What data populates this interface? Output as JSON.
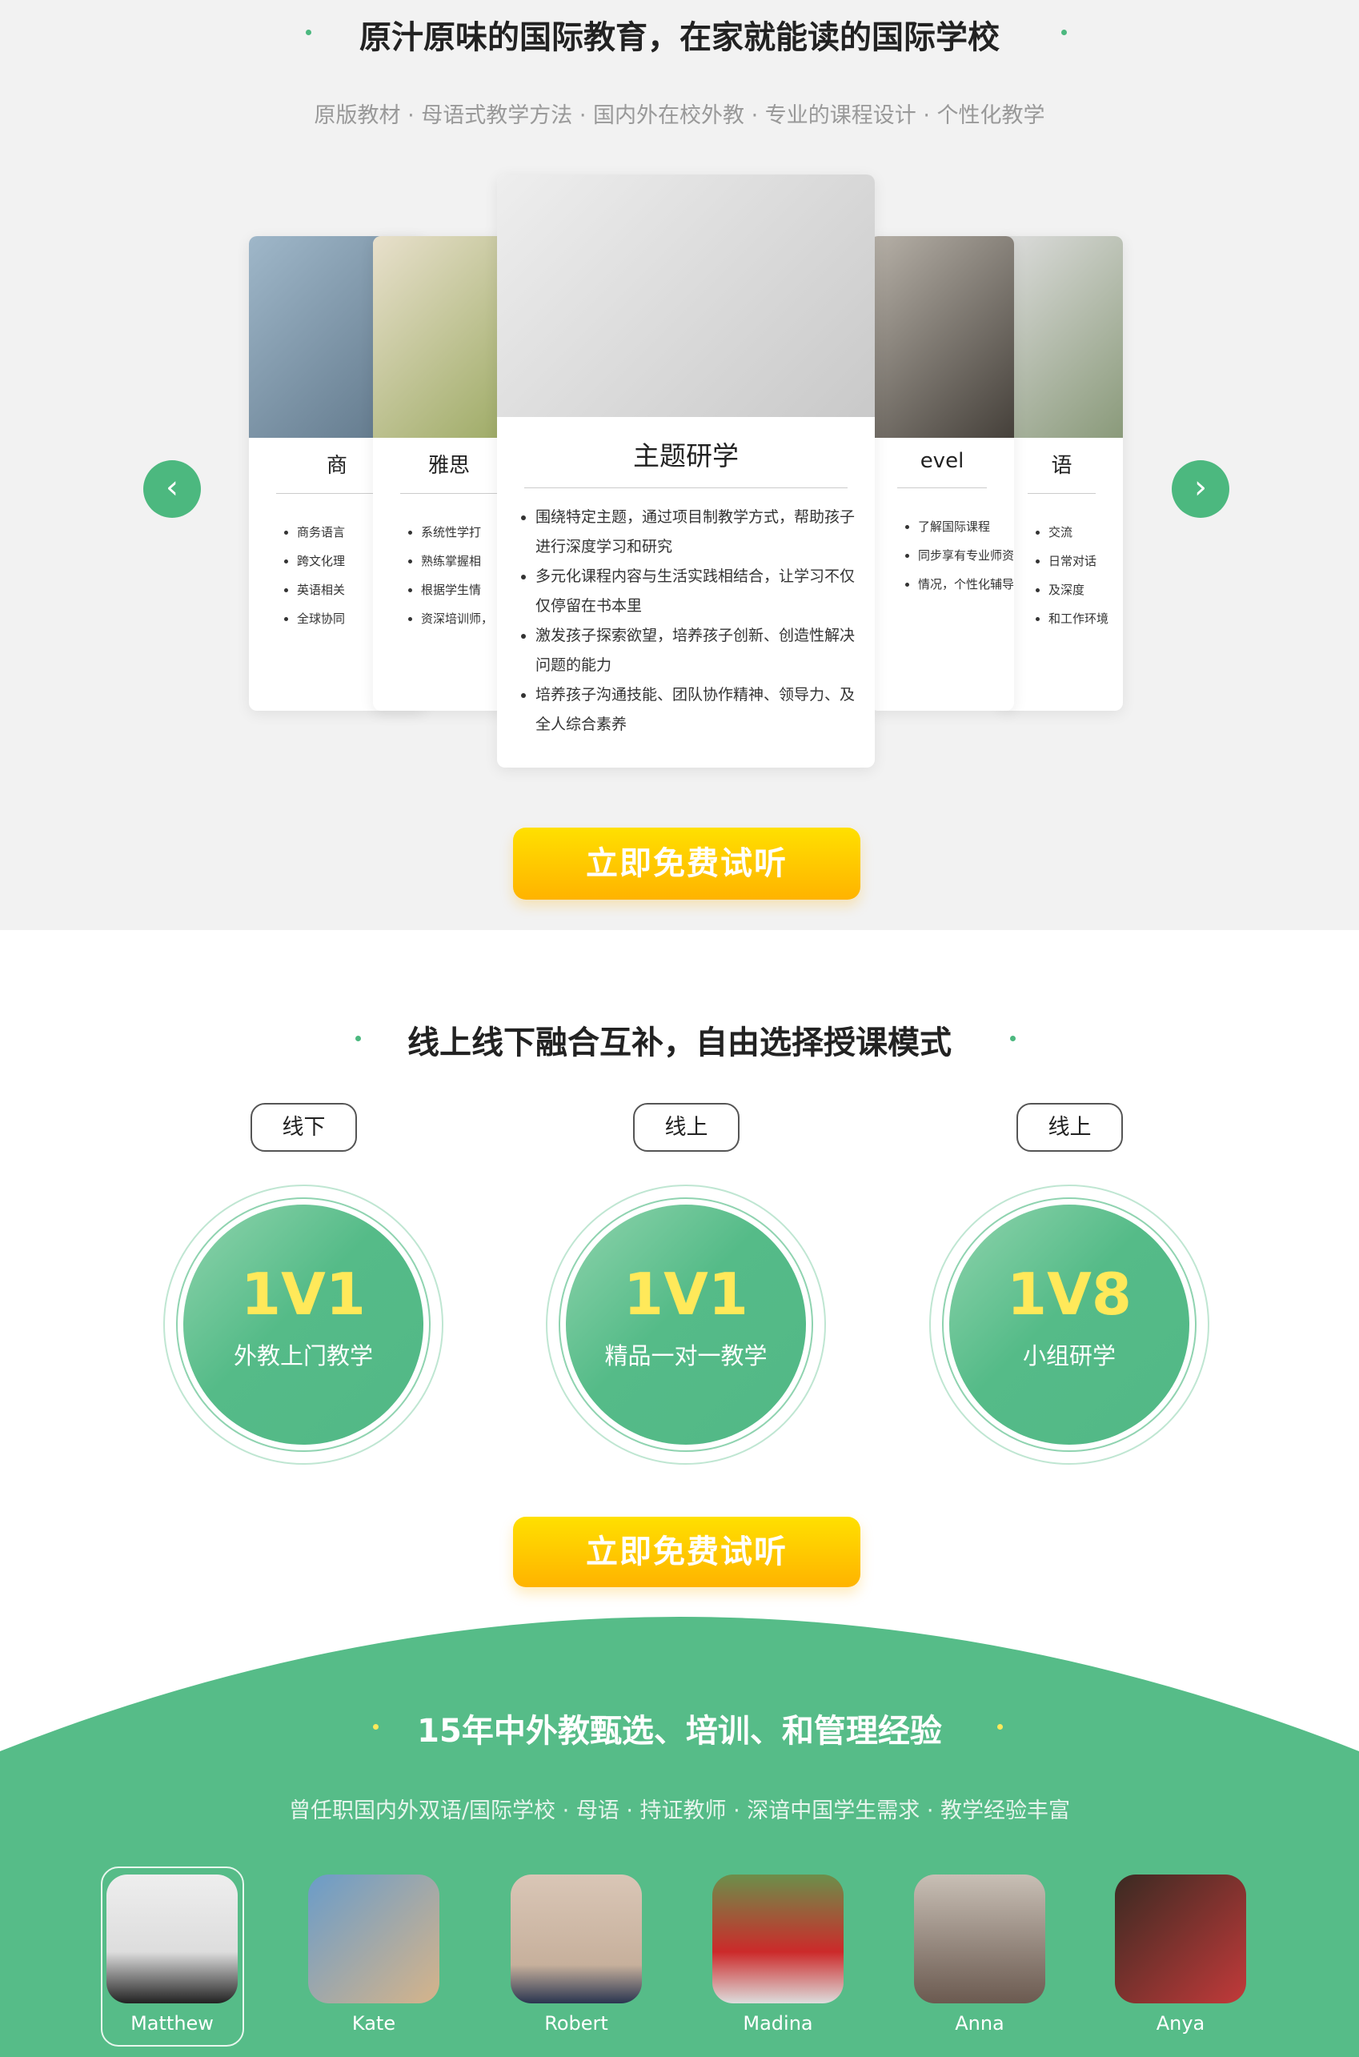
{
  "section1": {
    "title": "原汁原味的国际教育，在家就能读的国际学校",
    "subtitle": "原版教材 · 母语式教学方法 · 国内外在校外教 · 专业的课程设计 · 个性化教学",
    "cards": [
      {
        "title": "商",
        "items": [
          "商务语言",
          "跨文化理",
          "英语相关",
          "全球协同"
        ]
      },
      {
        "title": "雅思",
        "items": [
          "系统性学打",
          "熟练掌握相",
          "根据学生情",
          "资深培训师，"
        ]
      },
      {
        "title": "主题研学",
        "items": [
          "围绕特定主题，通过项目制教学方式，帮助孩子进行深度学习和研究",
          "多元化课程内容与生活实践相结合，让学习不仅仅停留在书本里",
          "激发孩子探索欲望，培养孩子创新、创造性解决问题的能力",
          "培养孩子沟通技能、团队协作精神、领导力、及全人综合素养"
        ]
      },
      {
        "title": "evel",
        "items": [
          "了解国际课程",
          "同步享有专业师资",
          "情况，个性化辅导"
        ]
      },
      {
        "title": "语",
        "items": [
          "交流",
          "日常对话",
          "及深度",
          "和工作环境"
        ]
      }
    ],
    "cta": "立即免费试听",
    "prev_icon": "chevron-left-icon",
    "next_icon": "chevron-right-icon"
  },
  "section2": {
    "title": "线上线下融合互补，自由选择授课模式",
    "modes": [
      {
        "tag": "线下",
        "big": "1V1",
        "label": "外教上门教学"
      },
      {
        "tag": "线上",
        "big": "1V1",
        "label": "精品一对一教学"
      },
      {
        "tag": "线上",
        "big": "1V8",
        "label": "小组研学"
      }
    ],
    "cta": "立即免费试听"
  },
  "section3": {
    "title": "15年中外教甄选、培训、和管理经验",
    "subtitle": "曾任职国内外双语/国际学校 · 母语 · 持证教师 · 深谙中国学生需求 · 教学经验丰富",
    "teachers": [
      {
        "name": "Matthew",
        "selected": true
      },
      {
        "name": "Kate"
      },
      {
        "name": "Robert"
      },
      {
        "name": "Madina"
      },
      {
        "name": "Anna"
      },
      {
        "name": "Anya"
      }
    ]
  },
  "colors": {
    "green": "#56bc88",
    "accent": "#4cb87f",
    "yellow": "#ffd200"
  }
}
